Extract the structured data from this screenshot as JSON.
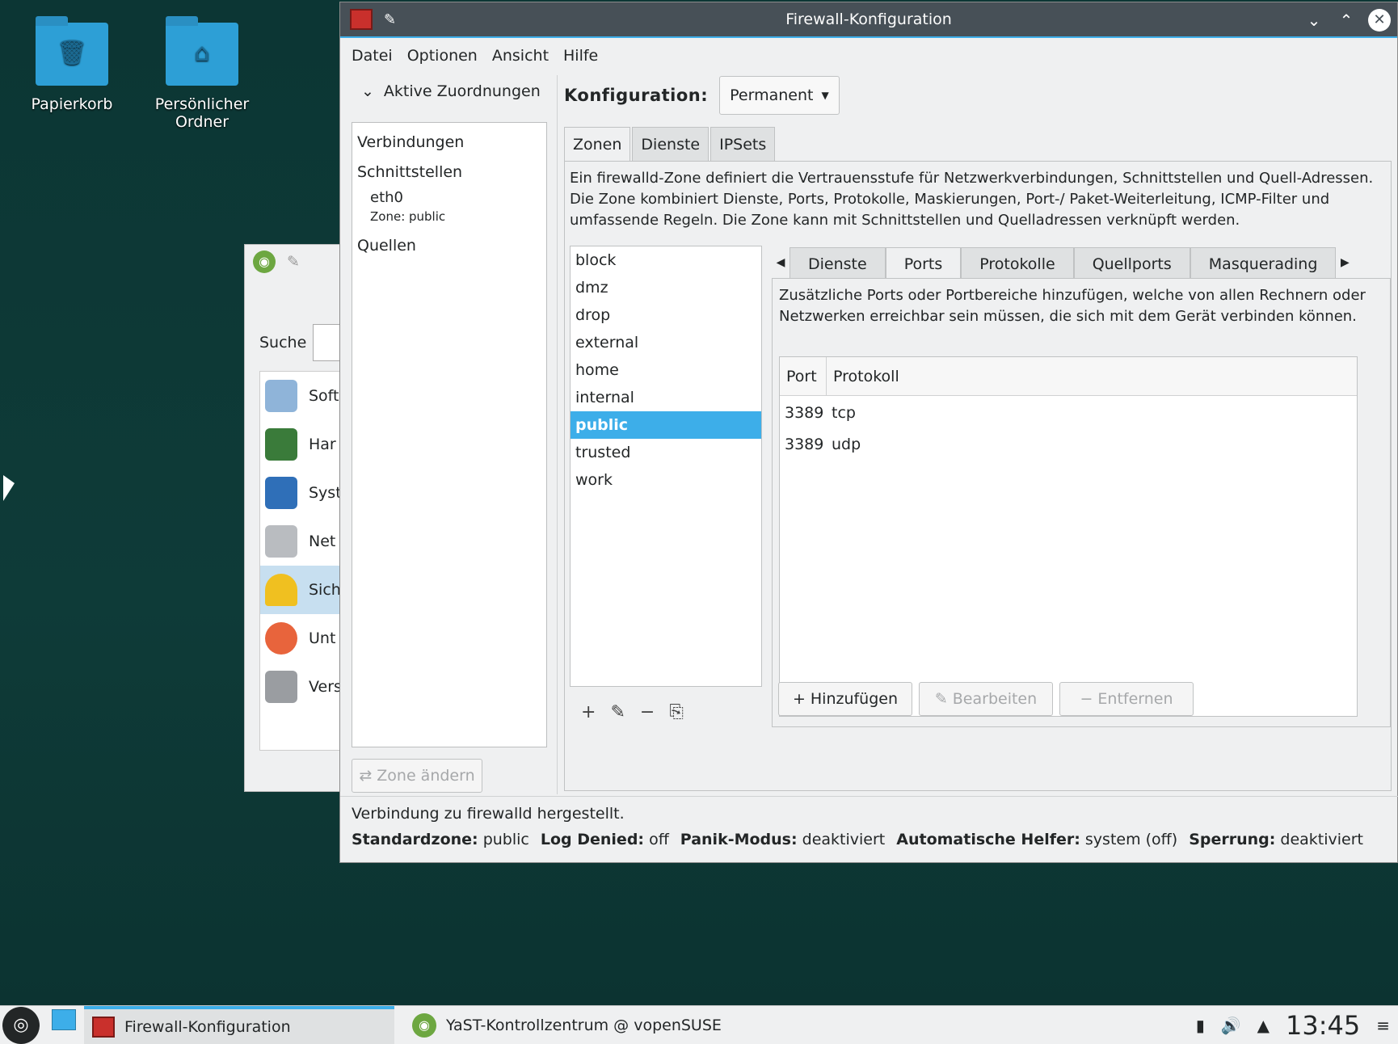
{
  "desktop": {
    "icons": [
      {
        "label": "Papierkorb"
      },
      {
        "label": "Persönlicher Ordner"
      }
    ]
  },
  "yast": {
    "search_label": "Suche",
    "items": [
      {
        "label": "Soft"
      },
      {
        "label": "Har"
      },
      {
        "label": "Syst"
      },
      {
        "label": "Net"
      },
      {
        "label": "Sich"
      },
      {
        "label": "Unt"
      },
      {
        "label": "Vers"
      }
    ]
  },
  "window": {
    "title": "Firewall-Konfiguration"
  },
  "menu": {
    "items": [
      "Datei",
      "Optionen",
      "Ansicht",
      "Hilfe"
    ]
  },
  "active": {
    "header": "Aktive Zuordnungen",
    "connections": "Verbindungen",
    "interfaces": "Schnittstellen",
    "interface_name": "eth0",
    "interface_zone": "Zone: public",
    "sources": "Quellen",
    "change_zone_button": "Zone ändern"
  },
  "config": {
    "label": "Konfiguration:",
    "value": "Permanent"
  },
  "outer_tabs": [
    "Zonen",
    "Dienste",
    "IPSets"
  ],
  "zone_description": "Ein firewalld-Zone definiert die Vertrauensstufe für Netzwerkverbindungen, Schnittstellen und Quell-Adressen. Die Zone kombiniert Dienste, Ports, Protokolle, Maskierungen, Port-/ Paket-Weiterleitung, ICMP-Filter und umfassende Regeln. Die Zone kann mit Schnittstellen und Quelladressen verknüpft werden.",
  "zones": [
    "block",
    "dmz",
    "drop",
    "external",
    "home",
    "internal",
    "public",
    "trusted",
    "work"
  ],
  "selected_zone": "public",
  "inner_tabs": [
    "Dienste",
    "Ports",
    "Protokolle",
    "Quellports",
    "Masquerading"
  ],
  "ports": {
    "description": "Zusätzliche Ports oder Portbereiche hinzufügen, welche von allen Rechnern oder Netzwerken erreichbar sein müssen, die sich mit dem Gerät verbinden können.",
    "columns": [
      "Port",
      "Protokoll"
    ],
    "rows": [
      {
        "port": "3389",
        "protocol": "tcp"
      },
      {
        "port": "3389",
        "protocol": "udp"
      }
    ],
    "add_button": "Hinzufügen",
    "edit_button": "Bearbeiten",
    "remove_button": "Entfernen"
  },
  "status": {
    "connected": "Verbindung zu firewalld hergestellt.",
    "default_zone_label": "Standardzone:",
    "default_zone": "public",
    "log_denied_label": "Log Denied:",
    "log_denied": "off",
    "panic_label": "Panik-Modus:",
    "panic": "deaktiviert",
    "helpers_label": "Automatische Helfer:",
    "helpers": "system (off)",
    "lock_label": "Sperrung:",
    "lock": "deaktiviert"
  },
  "taskbar": {
    "tasks": [
      {
        "label": "Firewall-Konfiguration"
      },
      {
        "label": "YaST-Kontrollzentrum @ vopenSUSE"
      }
    ],
    "clock": "13:45"
  },
  "colors": {
    "accent": "#3daee9",
    "titlebar": "#475057",
    "desktop": "#0e3b38"
  }
}
